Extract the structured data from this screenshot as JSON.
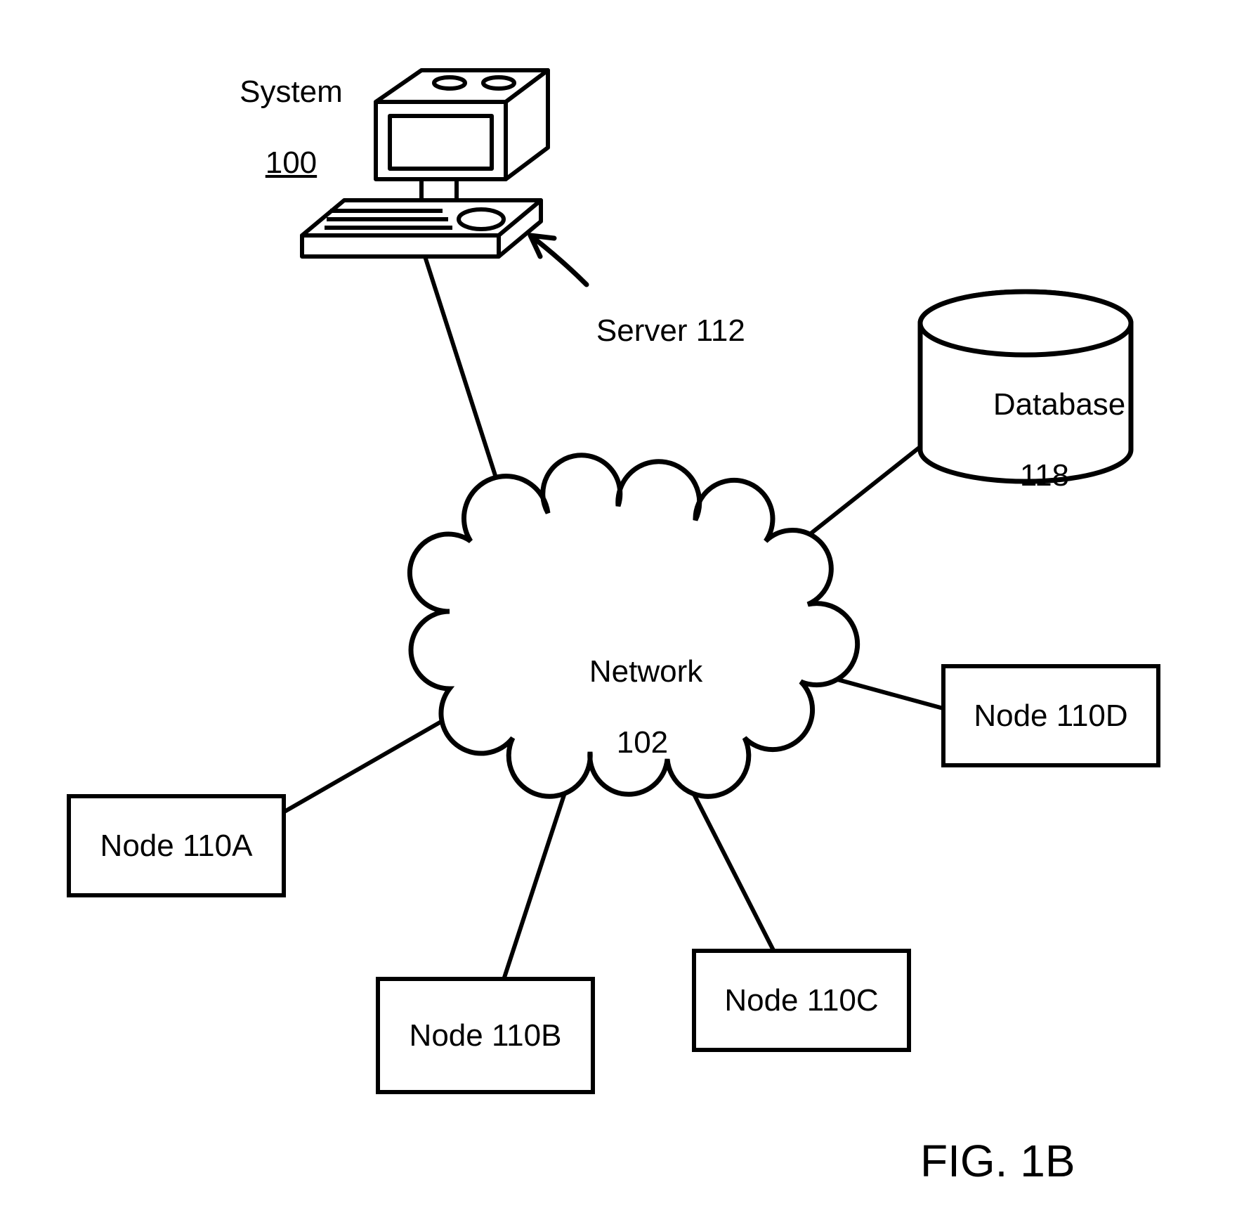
{
  "title": {
    "line1": "System",
    "line2": "100"
  },
  "server": {
    "label": "Server 112"
  },
  "database": {
    "line1": "Database",
    "line2": "118"
  },
  "network": {
    "line1": "Network",
    "line2": "102"
  },
  "nodes": {
    "a": "Node 110A",
    "b": "Node 110B",
    "c": "Node 110C",
    "d": "Node 110D"
  },
  "figure": "FIG. 1B"
}
